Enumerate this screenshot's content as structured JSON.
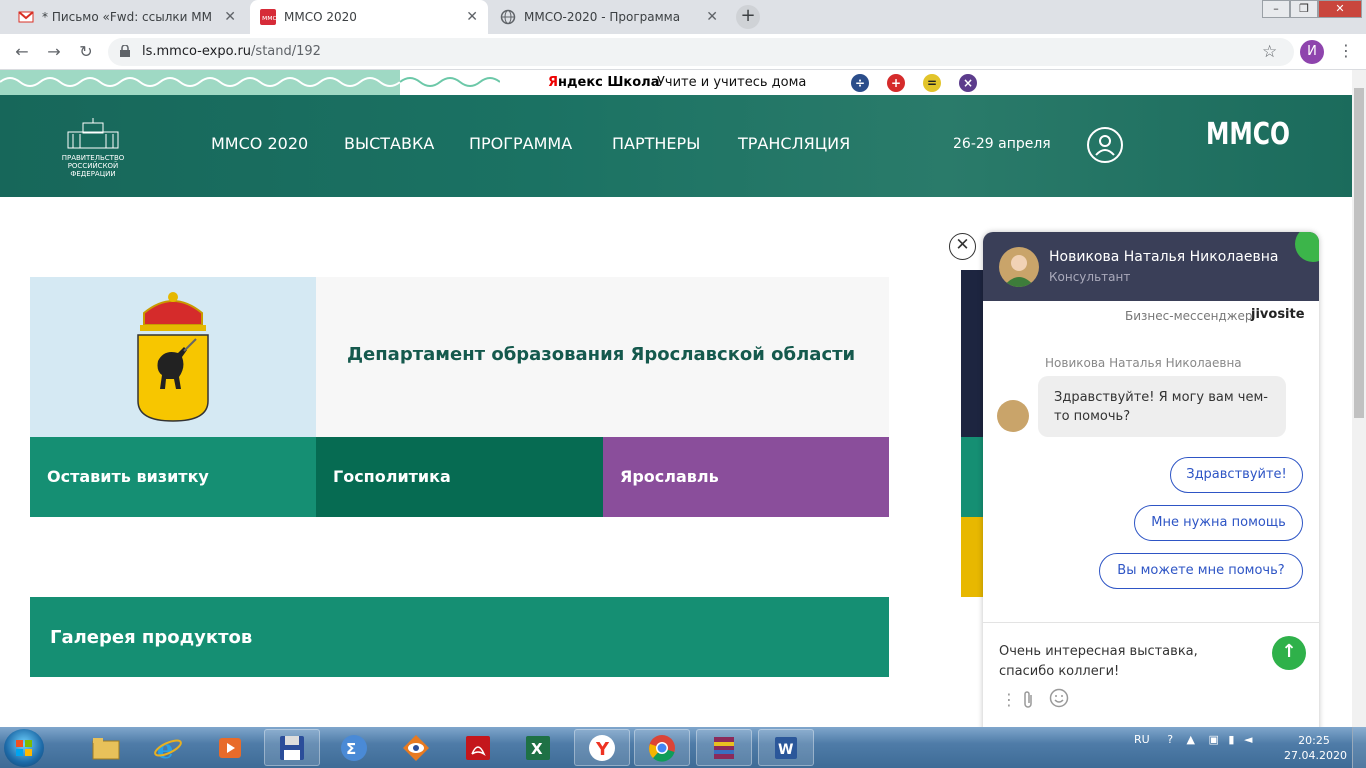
{
  "browser": {
    "tabs": [
      {
        "label": "* Письмо «Fwd: ссылки ММСО»",
        "icon": "gmail-icon"
      },
      {
        "label": "ММСО 2020",
        "icon": "site-icon"
      },
      {
        "label": "ММСО-2020 - Программа",
        "icon": "globe-icon"
      }
    ],
    "url_host": "ls.mmco-expo.ru",
    "url_path": "/stand/192",
    "profile_initial": "И"
  },
  "yandex_strip": {
    "brand_red": "Я",
    "brand_rest": "ндекс Школа",
    "slogan": "Учите и учитесь дома",
    "ops": [
      "÷",
      "+",
      "=",
      "×"
    ]
  },
  "site_header": {
    "gov_logo_text": "ПРАВИТЕЛЬСТВО РОССИЙСКОЙ ФЕДЕРАЦИИ",
    "nav": [
      "ММСО 2020",
      "ВЫСТАВКА",
      "ПРОГРАММА",
      "ПАРТНЕРЫ",
      "ТРАНСЛЯЦИЯ"
    ],
    "dates": "26-29 апреля",
    "brand": "ММСО"
  },
  "stand": {
    "title": "Департамент образования Ярославской области",
    "buttons": [
      "Оставить визитку",
      "Госполитика",
      "Ярославль"
    ],
    "gallery": "Галерея продуктов"
  },
  "chat": {
    "operator_name": "Новикова Наталья Николаевна",
    "operator_role": "Консультант",
    "powered_by": "Бизнес-мессенджер",
    "brand": "jivosite",
    "message_author": "Новикова Наталья Николаевна",
    "message": "Здравствуйте! Я могу вам чем-то помочь?",
    "quick_replies": [
      "Здравствуйте!",
      "Мне нужна помощь",
      "Вы можете мне помочь?"
    ],
    "input_text": "Очень интересная выставка, спасибо коллеги!"
  },
  "taskbar": {
    "lang": "RU",
    "time": "20:25",
    "date": "27.04.2020"
  },
  "colors": {
    "header_green": "#1b7263",
    "teal_button": "#158f73",
    "dark_green_button": "#066b52",
    "purple_button": "#8a4e9b",
    "chat_header": "#3a3f58",
    "send_green": "#2fb14a"
  }
}
